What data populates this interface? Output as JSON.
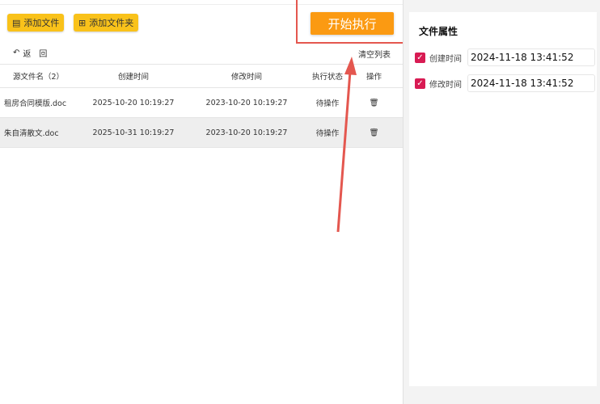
{
  "toolbar": {
    "add_file": "添加文件",
    "add_folder": "添加文件夹",
    "start": "开始执行",
    "back": "返　回",
    "clear": "清空列表"
  },
  "table": {
    "headers": [
      "源文件名（2）",
      "创建时间",
      "修改时间",
      "执行状态",
      "操作"
    ],
    "rows": [
      {
        "name": "租房合同模版.doc",
        "created": "2025-10-20 10:19:27",
        "modified": "2023-10-20 10:19:27",
        "status": "待操作"
      },
      {
        "name": "朱自清散文.doc",
        "created": "2025-10-31 10:19:27",
        "modified": "2023-10-20 10:19:27",
        "status": "待操作"
      }
    ]
  },
  "properties": {
    "title": "文件属性",
    "created_label": "创建时间",
    "created_value": "2024-11-18 13:41:52",
    "modified_label": "修改时间",
    "modified_value": "2024-11-18 13:41:52"
  },
  "colors": {
    "accent": "#fb9a12",
    "yellow": "#f9c21a",
    "annotation": "#e4574f",
    "checkbox": "#d81b53"
  }
}
